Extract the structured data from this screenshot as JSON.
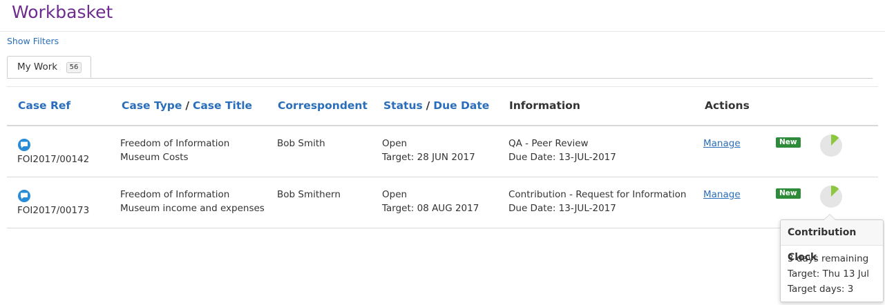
{
  "header": {
    "title": "Workbasket"
  },
  "filters": {
    "label": "Show Filters"
  },
  "tabs": [
    {
      "label": "My Work",
      "count": "56"
    }
  ],
  "columns": {
    "case_ref": "Case Ref",
    "case_type": "Case Type",
    "case_title": "Case Title",
    "correspondent": "Correspondent",
    "status": "Status",
    "due_date": "Due Date",
    "separator": "/",
    "information": "Information",
    "actions": "Actions"
  },
  "rows": [
    {
      "case_ref": "FOI2017/00142",
      "case_type": "Freedom of Information",
      "case_title": "Museum Costs",
      "correspondent": "Bob Smith",
      "status": "Open",
      "target": "Target: 28 JUN 2017",
      "info_title": "QA - Peer Review",
      "info_due": "Due Date: 13-JUL-2017",
      "action": "Manage",
      "badge": "New"
    },
    {
      "case_ref": "FOI2017/00173",
      "case_type": "Freedom of Information",
      "case_title": "Museum income and expenses",
      "correspondent": "Bob Smithern",
      "status": "Open",
      "target": "Target: 08 AUG 2017",
      "info_title": "Contribution - Request for Information",
      "info_due": "Due Date: 13-JUL-2017",
      "action": "Manage",
      "badge": "New"
    }
  ],
  "tooltip": {
    "title": "Contribution Clock",
    "remaining": "3 days remaining",
    "target": "Target: Thu 13 Jul",
    "target_days": "Target days: 3"
  },
  "colors": {
    "title": "#6d2c8e",
    "link": "#2a6ebb",
    "new_badge": "#2e8b3a",
    "clock_fill": "#8dc63f",
    "clock_bg": "#e5e5e5"
  }
}
